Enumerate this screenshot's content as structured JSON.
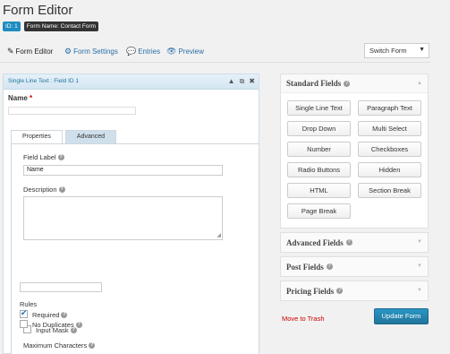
{
  "page": {
    "title": "Form Editor"
  },
  "badges": {
    "id": "ID: 1",
    "form_name": "Form Name: Contact Form"
  },
  "toolbar": {
    "form_editor": "Form Editor",
    "form_settings": "Form Settings",
    "entries": "Entries",
    "preview": "Preview",
    "switch_form": "Switch Form"
  },
  "editor": {
    "header": "Single Line Text : Field ID 1",
    "field_title": "Name",
    "required_mark": "*",
    "tabs": [
      "Properties",
      "Advanced"
    ],
    "field_label_label": "Field Label",
    "field_label_value": "Name",
    "description_label": "Description",
    "input_mask_label": "Input Mask",
    "max_chars_label": "Maximum Characters",
    "rules_label": "Rules",
    "required_label": "Required",
    "no_duplicates_label": "No Duplicates",
    "required_checked": true,
    "no_duplicates_checked": false,
    "input_mask_checked": false
  },
  "sidebar": {
    "standard_fields": "Standard Fields",
    "fields": [
      "Single Line Text",
      "Paragraph Text",
      "Drop Down",
      "Multi Select",
      "Number",
      "Checkboxes",
      "Radio Buttons",
      "Hidden",
      "HTML",
      "Section Break",
      "Page Break"
    ],
    "advanced_fields": "Advanced Fields",
    "post_fields": "Post Fields",
    "pricing_fields": "Pricing Fields"
  },
  "actions": {
    "trash": "Move to Trash",
    "update": "Update Form"
  },
  "colors": {
    "accent": "#21759b",
    "danger": "#cc0000",
    "badge_id": "#1e8cbe",
    "badge_name": "#333333"
  }
}
